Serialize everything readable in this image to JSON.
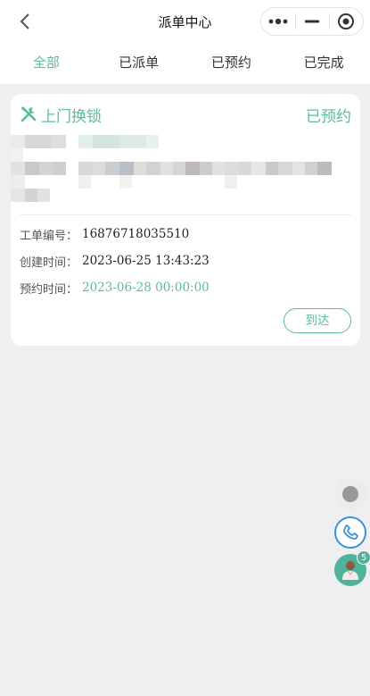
{
  "header": {
    "title": "派单中心",
    "back_icon": "chevron-left-icon",
    "more_icon": "more-dots-icon",
    "minimize_icon": "minimize-icon",
    "close_icon": "target-close-icon"
  },
  "tabs": [
    {
      "label": "全部",
      "active": true
    },
    {
      "label": "已派单",
      "active": false
    },
    {
      "label": "已预约",
      "active": false
    },
    {
      "label": "已完成",
      "active": false
    }
  ],
  "order": {
    "service_icon": "wrench-screwdriver-icon",
    "service_name": "上门换锁",
    "status": "已预约",
    "fields": [
      {
        "label": "工单编号：",
        "value": "16876718035510",
        "accent": false
      },
      {
        "label": "创建时间：",
        "value": "2023-06-25 13:43:23",
        "accent": false
      },
      {
        "label": "预约时间：",
        "value": "2023-06-28 00:00:00",
        "accent": true
      }
    ],
    "action_label": "到达"
  },
  "floating": {
    "record_icon": "record-dot-icon",
    "phone_icon": "phone-icon",
    "service_icon": "customer-service-avatar-icon",
    "service_badge": "5"
  },
  "colors": {
    "accent": "#5bbaa0",
    "background": "#efeff1",
    "phone": "#3e90d6"
  }
}
